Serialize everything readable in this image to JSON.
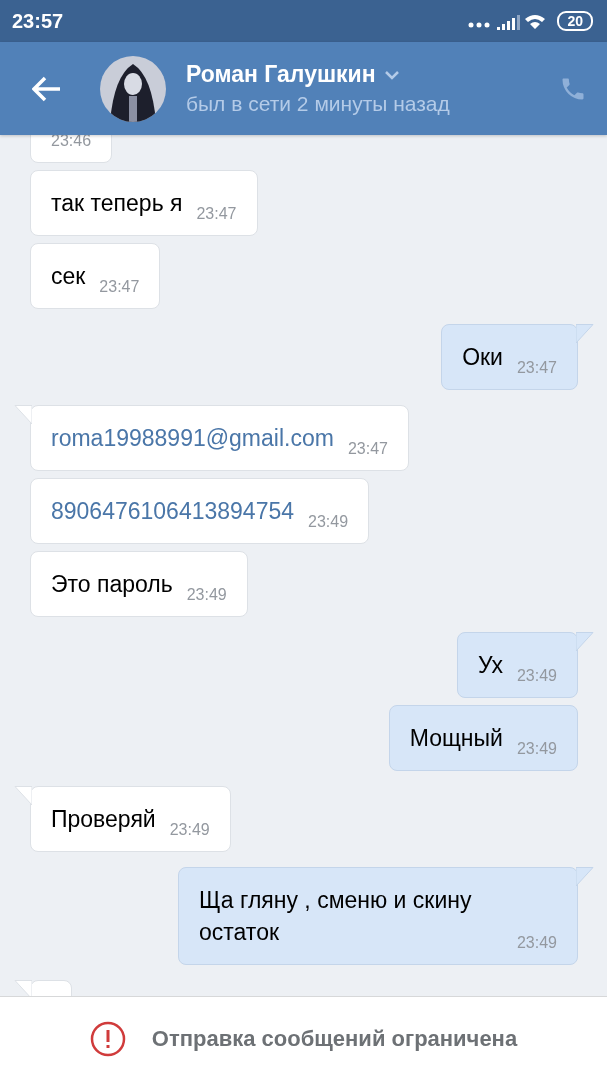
{
  "status_bar": {
    "time": "23:57",
    "battery": "20"
  },
  "header": {
    "name": "Роман Галушкин",
    "status": "был в сети 2 минуты назад"
  },
  "messages": [
    {
      "outgoing": false,
      "time": "23:46"
    },
    {
      "outgoing": false,
      "tail": false,
      "kind": "plain",
      "text": "так теперь я",
      "time": "23:47"
    },
    {
      "outgoing": false,
      "tail": false,
      "kind": "plain",
      "text": "сек",
      "time": "23:47"
    },
    {
      "outgoing": true,
      "tail": true,
      "kind": "plain",
      "text": "Оки",
      "time": "23:47"
    },
    {
      "outgoing": false,
      "tail": true,
      "kind": "link",
      "text": "roma19988991@gmail.com",
      "time": "23:47"
    },
    {
      "outgoing": false,
      "tail": false,
      "kind": "link",
      "text": "8906476106413894754",
      "time": "23:49"
    },
    {
      "outgoing": false,
      "tail": false,
      "kind": "plain",
      "text": "Это пароль",
      "time": "23:49"
    },
    {
      "outgoing": true,
      "tail": true,
      "kind": "plain",
      "text": "Ух",
      "time": "23:49"
    },
    {
      "outgoing": true,
      "tail": false,
      "kind": "plain",
      "text": "Мощный",
      "time": "23:49"
    },
    {
      "outgoing": false,
      "tail": true,
      "kind": "plain",
      "text": "Проверяй",
      "time": "23:49"
    },
    {
      "outgoing": true,
      "tail": true,
      "kind": "plain",
      "text": "Ща гляну , сменю и скину остаток",
      "time": "23:49"
    },
    {
      "outgoing": false,
      "tail": true
    }
  ],
  "notice": "Отправка сообщений ограничена"
}
